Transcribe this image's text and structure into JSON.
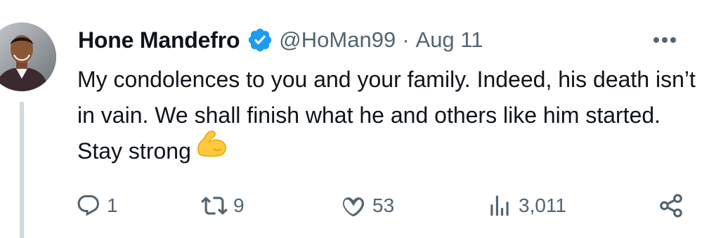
{
  "tweet": {
    "author_name": "Hone Mandefro",
    "handle": "@HoMan99",
    "separator": "·",
    "date": "Aug 11",
    "text": "My condolences to you and your family. Indeed, his death isn’t in vain. We shall finish what he and others like him started. Stay strong",
    "emoji": "flexed-biceps-emoji"
  },
  "actions": {
    "reply_count": "1",
    "retweet_count": "9",
    "like_count": "53",
    "views_count": "3,011"
  },
  "icons": {
    "verified": "verified-badge-icon",
    "more": "more-options-icon",
    "reply": "reply-icon",
    "retweet": "retweet-icon",
    "like": "heart-icon",
    "views": "views-icon",
    "share": "share-icon"
  },
  "colors": {
    "verified_blue": "#1d9bf0",
    "text": "#0f1419",
    "secondary": "#536471",
    "thread_line": "#cfd9de"
  }
}
